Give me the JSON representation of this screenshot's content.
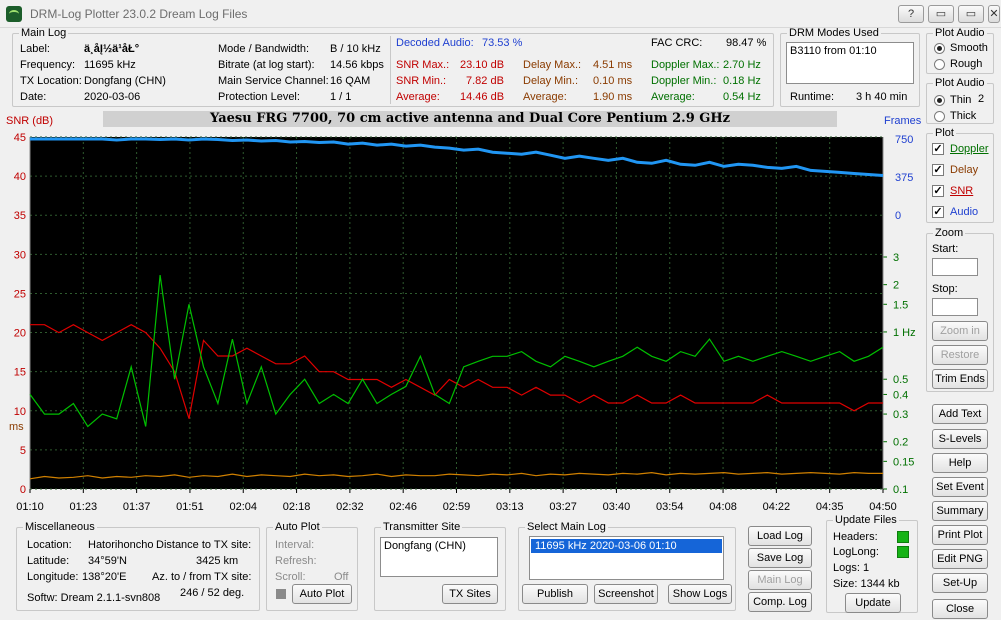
{
  "window": {
    "title": "DRM-Log Plotter 23.0.2   Dream Log Files",
    "buttons": [
      "?",
      "▭",
      "▭",
      "✕"
    ]
  },
  "main_log": {
    "legend": "Main Log",
    "label_key": "Label:",
    "label_val": "ä¸­åĮ½ä¹åŁ°",
    "freq_key": "Frequency:",
    "freq_val": "11695   kHz",
    "txloc_key": "TX Location:",
    "txloc_val": "Dongfang (CHN)",
    "date_key": "Date:",
    "date_val": "2020-03-06",
    "mode_key": "Mode / Bandwidth:",
    "mode_val": "B / 10 kHz",
    "bitrate_key": "Bitrate (at log start):",
    "bitrate_val": "14.56 kbps",
    "msc_key": "Main Service Channel:",
    "msc_val": "16  QAM",
    "prot_key": "Protection Level:",
    "prot_val": "1 / 1",
    "decoded_key": "Decoded Audio:",
    "decoded_val": "73.53 %",
    "fac_key": "FAC  CRC:",
    "fac_val": "98.47 %",
    "snrmax_key": "SNR Max.:",
    "snrmax_val": "23.10  dB",
    "snrmin_key": "SNR Min.:",
    "snrmin_val": "7.82  dB",
    "snravg_key": "Average:",
    "snravg_val": "14.46  dB",
    "delaymax_key": "Delay Max.:",
    "delaymax_val": "4.51    ms",
    "delaymin_key": "Delay Min.:",
    "delaymin_val": "0.10    ms",
    "delayavg_key": "Average:",
    "delayavg_val": "1.90    ms",
    "dopmax_key": "Doppler Max.:",
    "dopmax_val": "2.70 Hz",
    "dopmin_key": "Doppler Min.:",
    "dopmin_val": "0.18 Hz",
    "dopavg_key": "Average:",
    "dopavg_val": "0.54 Hz"
  },
  "drm_modes": {
    "legend": "DRM Modes Used",
    "entry": "B3110 from 01:10",
    "runtime_key": "Runtime:",
    "runtime_val": "3 h 40 min"
  },
  "plot_audio1": {
    "legend": "Plot Audio",
    "opt1": "Smooth",
    "opt2": "Rough"
  },
  "plot_audio2": {
    "legend": "Plot Audio",
    "opt1": "Thin",
    "num": "2",
    "opt2": "Thick"
  },
  "plot_panel": {
    "legend": "Plot",
    "items": [
      "Doppler",
      "Delay",
      "SNR",
      "Audio"
    ]
  },
  "zoom": {
    "legend": "Zoom",
    "start": "Start:",
    "stop": "Stop:",
    "zoom_in": "Zoom in",
    "restore": "Restore",
    "trim": "Trim Ends"
  },
  "right_buttons": [
    "Add Text",
    "S-Levels",
    "Help",
    "Set Event",
    "Summary",
    "Print Plot",
    "Edit PNG",
    "Set-Up"
  ],
  "close": "Close",
  "banner": "Yaesu FRG 7700, 70 cm active antenna and Dual Core Pentium 2.9 GHz",
  "axes": {
    "snr_label": "SNR (dB)",
    "ms_label": "ms",
    "frames_label": "Frames",
    "snr_ticks": [
      "45",
      "40",
      "35",
      "30",
      "25",
      "20",
      "15",
      "10",
      "5",
      "0"
    ],
    "frames_ticks": [
      "750",
      "375",
      "0"
    ],
    "hz_ticks": [
      "3",
      "2",
      "1.5",
      "1 Hz",
      "0.5",
      "0.4",
      "0.3",
      "0.2",
      "0.15",
      "0.1"
    ],
    "time_ticks": [
      "01:10",
      "01:23",
      "01:37",
      "01:51",
      "02:04",
      "02:18",
      "02:32",
      "02:46",
      "02:59",
      "03:13",
      "03:27",
      "03:40",
      "03:54",
      "04:08",
      "04:22",
      "04:35",
      "04:50"
    ]
  },
  "chart_data": {
    "type": "line",
    "x_range": [
      "01:10",
      "04:50"
    ],
    "ylim_snr": [
      0,
      45
    ],
    "ylim_frames": [
      0,
      750
    ],
    "series": [
      {
        "name": "SNR",
        "color": "#e00000",
        "values": [
          21,
          21,
          20,
          21,
          20,
          19,
          20,
          21,
          20,
          18,
          15,
          9,
          19,
          17,
          17,
          18,
          17,
          16,
          16,
          17,
          15,
          15,
          14,
          14,
          14,
          13,
          14,
          13,
          12,
          14,
          13,
          14,
          13,
          13,
          12,
          13,
          12,
          12,
          11,
          12,
          11,
          11,
          12,
          11,
          11,
          12,
          11,
          11,
          11,
          11,
          11,
          12,
          11,
          11,
          11,
          11,
          11,
          10,
          11,
          11
        ]
      },
      {
        "name": "Doppler",
        "color": "#00c000",
        "values": [
          0.4,
          0.3,
          0.3,
          0.35,
          0.25,
          0.3,
          0.28,
          0.6,
          0.25,
          2.3,
          0.5,
          1.5,
          0.6,
          0.35,
          0.9,
          0.35,
          0.6,
          0.3,
          0.4,
          0.5,
          0.35,
          0.4,
          0.35,
          0.5,
          0.35,
          0.4,
          0.45,
          0.7,
          0.4,
          0.35,
          0.6,
          0.65,
          0.7,
          0.7,
          0.75,
          0.65,
          0.6,
          0.7,
          0.65,
          0.6,
          0.65,
          0.7,
          0.8,
          0.7,
          0.65,
          0.75,
          0.7,
          0.9,
          0.65,
          0.7,
          0.65,
          0.7,
          0.75,
          0.7,
          0.65,
          0.7,
          0.75,
          0.65,
          0.7,
          0.8
        ]
      },
      {
        "name": "Delay",
        "color": "#d08000",
        "values": [
          1.3,
          1.6,
          1.4,
          1.5,
          1.7,
          1.4,
          1.6,
          1.5,
          1.7,
          1.6,
          1.8,
          1.5,
          1.7,
          1.6,
          1.9,
          1.6,
          1.8,
          1.7,
          1.6,
          1.9,
          1.7,
          1.8,
          1.6,
          1.7,
          1.9,
          1.6,
          1.8,
          1.7,
          1.7,
          1.9,
          1.8,
          1.7,
          1.9,
          1.8,
          2.0,
          1.7,
          1.9,
          1.8,
          2.0,
          1.9,
          1.8,
          2.0,
          1.9,
          2.1,
          1.8,
          2.0,
          1.9,
          2.0,
          2.1,
          1.9,
          2.0,
          2.1,
          1.9,
          2.0,
          2.1,
          2.0,
          1.9,
          2.1,
          2.0,
          2.0
        ]
      },
      {
        "name": "Audio",
        "color": "#2196f3",
        "values": [
          750,
          750,
          750,
          750,
          750,
          750,
          740,
          750,
          750,
          745,
          750,
          740,
          750,
          745,
          735,
          740,
          730,
          735,
          720,
          725,
          715,
          720,
          700,
          710,
          690,
          700,
          680,
          690,
          670,
          660,
          640,
          650,
          620,
          610,
          600,
          620,
          590,
          560,
          580,
          560,
          540,
          560,
          520,
          510,
          540,
          500,
          490,
          520,
          480,
          500,
          490,
          470,
          460,
          480,
          440,
          430,
          420,
          410,
          400,
          390
        ]
      }
    ]
  },
  "misc": {
    "legend": "Miscellaneous",
    "location_key": "Location:",
    "location_val": "Hatorihoncho",
    "lat_key": "Latitude:",
    "lat_val": "34°59'N",
    "lon_key": "Longitude:",
    "lon_val": "138°20'E",
    "dist_key": "Distance to TX site:",
    "dist_val": "3425    km",
    "az_key": "Az. to / from TX site:",
    "az_val": "246 / 52  deg.",
    "softw": "Softw: Dream 2.1.1-svn808"
  },
  "auto_plot": {
    "legend": "Auto Plot",
    "interval": "Interval:",
    "refresh": "Refresh:",
    "scroll": "Scroll:",
    "scroll_val": "Off",
    "button": "Auto Plot"
  },
  "tx_site": {
    "legend": "Transmitter Site",
    "entry": "Dongfang (CHN)",
    "button": "TX Sites"
  },
  "select_log": {
    "legend": "Select Main Log",
    "entry": "11695 kHz  2020-03-06   01:10",
    "publish": "Publish",
    "screenshot": "Screenshot",
    "show_logs": "Show Logs"
  },
  "log_buttons": {
    "load": "Load Log",
    "save": "Save Log",
    "main": "Main Log",
    "comp": "Comp. Log"
  },
  "update_files": {
    "legend": "Update Files",
    "headers": "Headers:",
    "loglong": "LogLong:",
    "logs": "Logs: 1",
    "size": "Size:  1344 kb",
    "button": "Update"
  }
}
